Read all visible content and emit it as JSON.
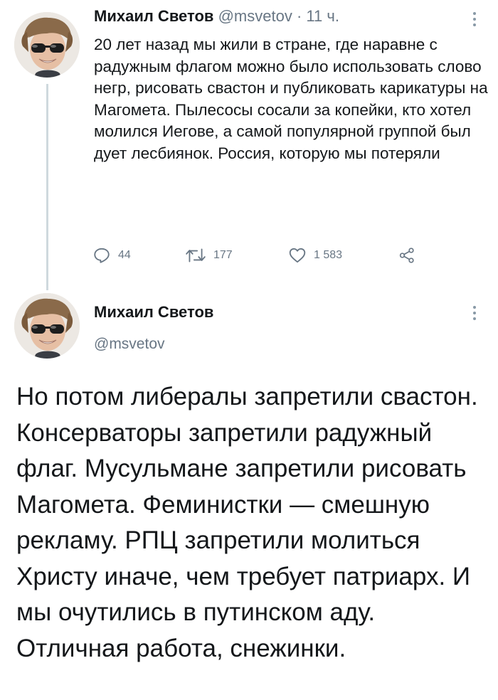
{
  "tweet1": {
    "author_name": "Михаил Светов",
    "handle": "@msvetov",
    "separator": "·",
    "time": "11 ч.",
    "text": "20 лет назад мы жили в стране, где наравне с радужным флагом можно было использовать слово негр, рисовать свастон и публиковать карикатуры на Магомета. Пылесосы сосали за копейки, кто хотел молился Иегове, а самой популярной группой был дует лесбиянок. Россия, которую мы потеряли",
    "reply_count": "44",
    "retweet_count": "177",
    "like_count": "1 583"
  },
  "tweet2": {
    "author_name": "Михаил Светов",
    "handle": "@msvetov",
    "text": "Но потом либералы запретили свастон. Консерваторы запретили радужный флаг. Мусульмане запретили рисовать Магомета. Феминистки — смешную рекламу. РПЦ запретили молиться Христу иначе, чем требует патриарх. И мы очутились в путинском аду. Отличная работа, снежинки."
  },
  "icons": {
    "more": "more-vertical-icon",
    "reply": "reply-icon",
    "retweet": "retweet-icon",
    "like": "heart-icon",
    "share": "share-icon"
  },
  "colors": {
    "text": "#14171a",
    "muted": "#687684",
    "thread_line": "#cfd9de"
  }
}
